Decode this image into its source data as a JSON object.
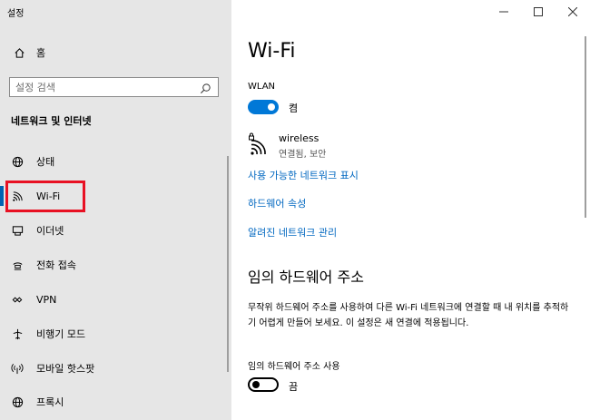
{
  "window": {
    "title": "설정"
  },
  "sidebar": {
    "home_label": "홈",
    "search_placeholder": "설정 검색",
    "section_title": "네트워크 및 인터넷",
    "items": [
      {
        "label": "상태",
        "icon": "globe-icon"
      },
      {
        "label": "Wi-Fi",
        "icon": "wifi-icon"
      },
      {
        "label": "이더넷",
        "icon": "ethernet-icon"
      },
      {
        "label": "전화 접속",
        "icon": "dialup-icon"
      },
      {
        "label": "VPN",
        "icon": "vpn-icon"
      },
      {
        "label": "비행기 모드",
        "icon": "airplane-icon"
      },
      {
        "label": "모바일 핫스팟",
        "icon": "hotspot-icon"
      },
      {
        "label": "프록시",
        "icon": "proxy-globe-icon"
      }
    ]
  },
  "main": {
    "title": "Wi-Fi",
    "wlan_label": "WLAN",
    "wlan_state": "켬",
    "network": {
      "name": "wireless",
      "status": "연결됨, 보안"
    },
    "links": [
      "사용 가능한 네트워크 표시",
      "하드웨어 속성",
      "알려진 네트워크 관리"
    ],
    "random_section_title": "임의 하드웨어 주소",
    "random_description": "무작위 하드웨어 주소를 사용하여 다른 Wi-Fi 네트워크에 연결할 때 내 위치를 추적하기 어렵게 만들어 보세요. 이 설정은 새 연결에 적용됩니다.",
    "random_label": "임의 하드웨어 주소 사용",
    "random_state": "끔"
  },
  "colors": {
    "accent": "#0078d7",
    "link": "#0067c0",
    "highlight": "#e81123",
    "sidebar_bg": "#e6e6e6"
  }
}
